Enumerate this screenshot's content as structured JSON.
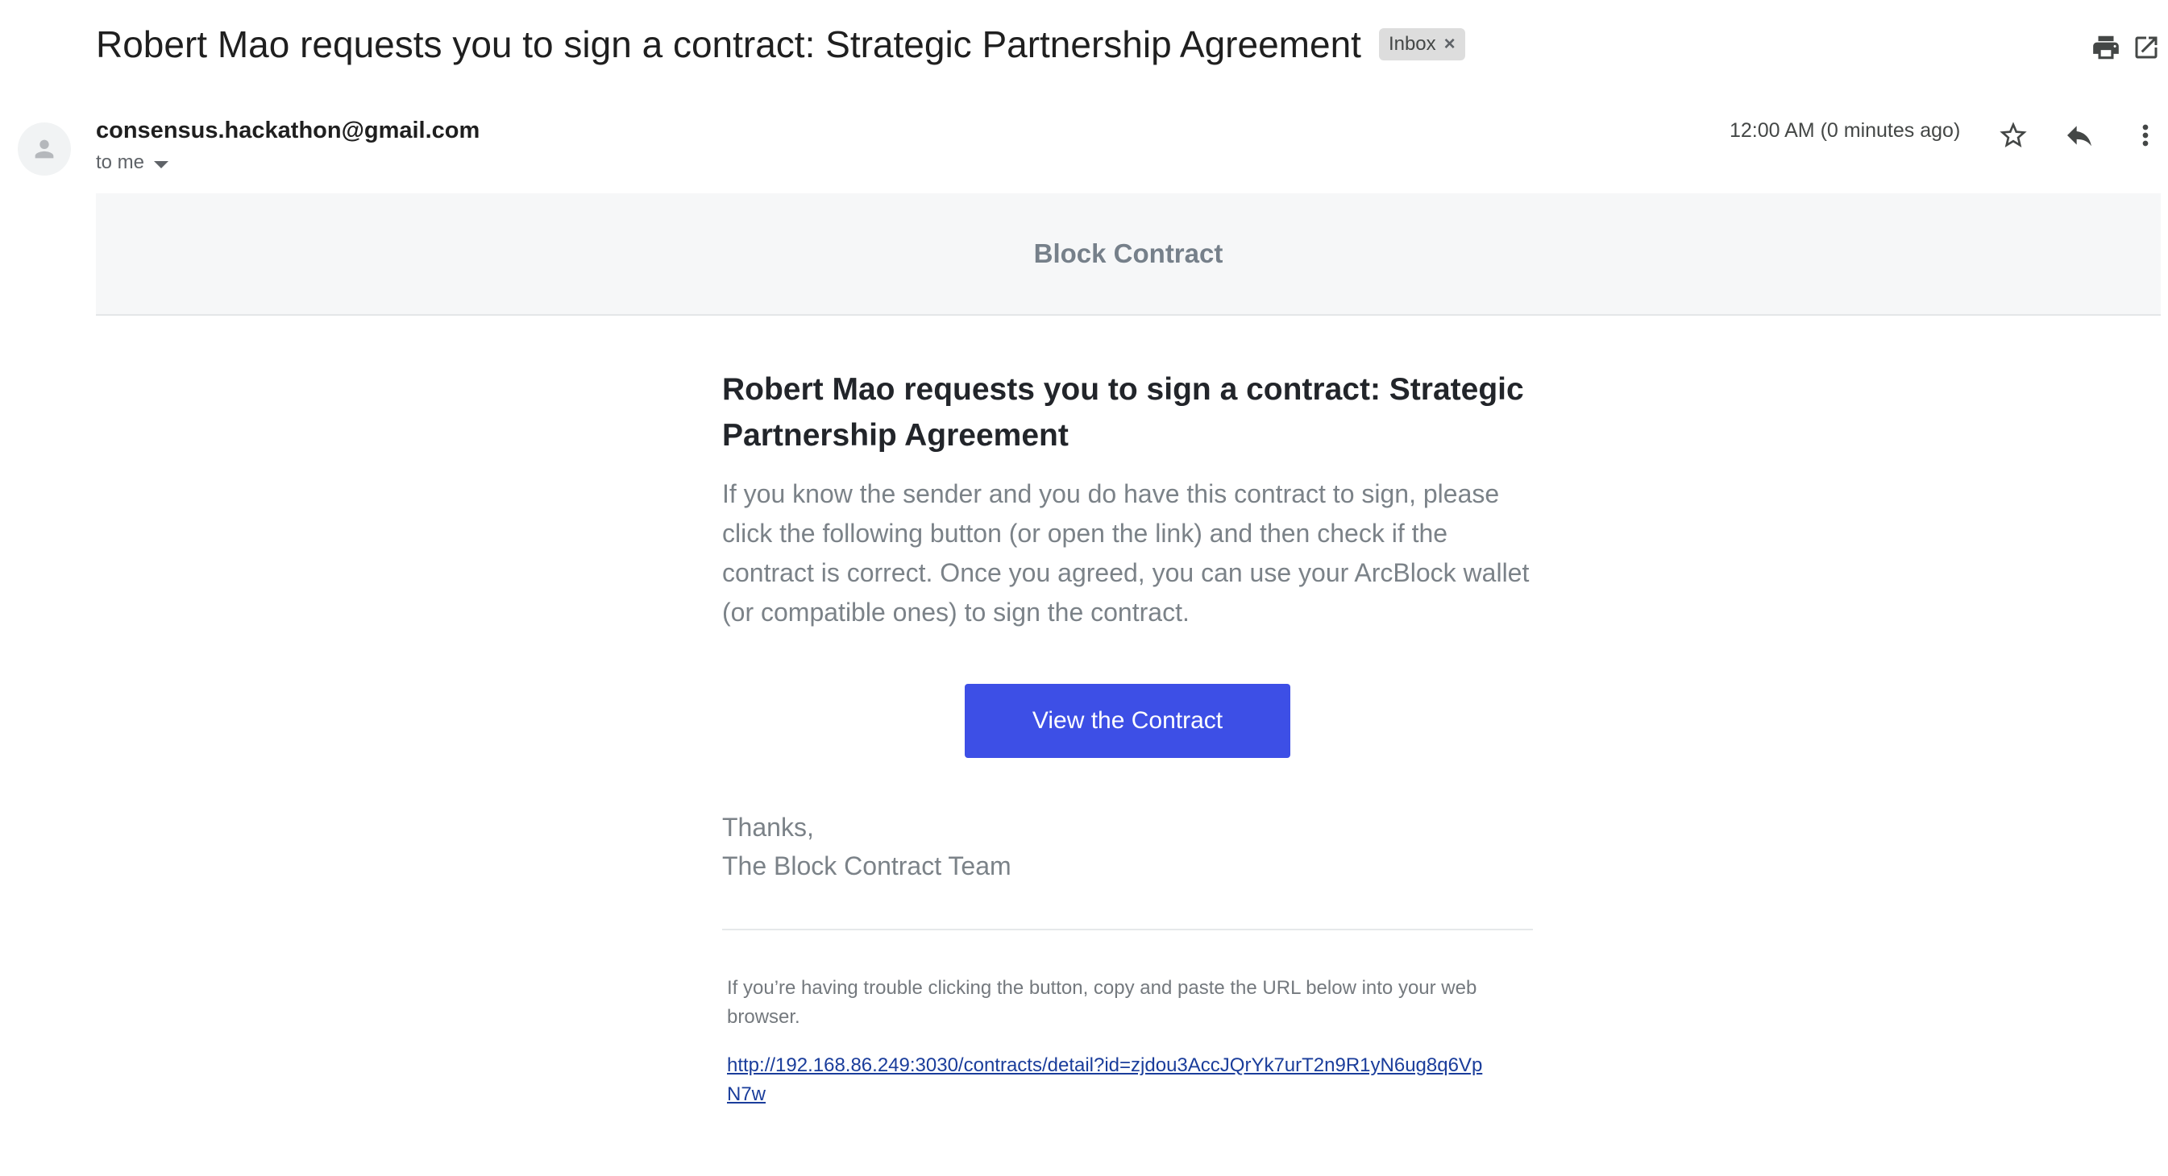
{
  "email": {
    "subject": "Robert Mao requests you to sign a contract: Strategic Partnership Agreement",
    "label_chip": "Inbox",
    "label_chip_remove": "×",
    "sender_email": "consensus.hackathon@gmail.com",
    "recipient_text": "to me",
    "timestamp": "12:00 AM (0 minutes ago)",
    "icons": [
      "print-icon",
      "open-in-new-window-icon",
      "avatar-icon",
      "star-icon",
      "reply-icon",
      "more-vert-icon",
      "dropdown-caret-icon"
    ]
  },
  "body": {
    "banner_title": "Block Contract",
    "heading": "Robert Mao requests you to sign a contract: Strategic Partnership Agreement",
    "paragraph": "If you know the sender and you do have this contract to sign, please click the following button (or open the link) and then check if the contract is correct. Once you agreed, you can use your ArcBlock wallet (or compatible ones) to sign the contract.",
    "button_label": "View the Contract",
    "signoff_line1": "Thanks,",
    "signoff_line2": "The Block Contract Team",
    "trouble_text": "If you’re having trouble clicking the button, copy and paste the URL below into your web browser.",
    "url": "http://192.168.86.249:3030/contracts/detail?id=zjdou3AccJQrYk7urT2n9R1yN6ug8q6VpN7w"
  },
  "colors": {
    "button_bg": "#3d4fe6",
    "banner_bg": "#f6f7f8",
    "link": "#1a3d9b"
  }
}
